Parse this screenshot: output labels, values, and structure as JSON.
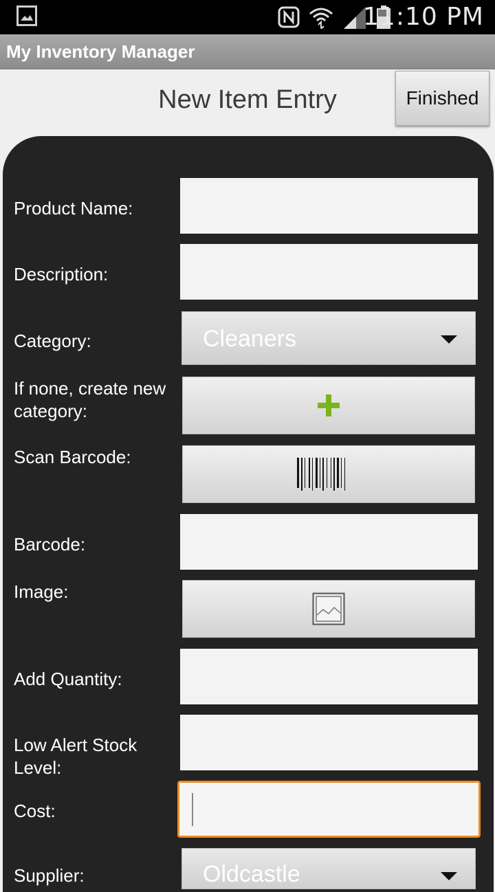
{
  "status_bar": {
    "time": "11:10 PM",
    "icons": [
      "gallery-icon",
      "nfc-icon",
      "wifi-icon",
      "signal-icon",
      "battery-icon"
    ]
  },
  "app": {
    "title": "My Inventory Manager"
  },
  "header": {
    "title": "New Item Entry",
    "finished_label": "Finished"
  },
  "form": {
    "product_name": {
      "label": "Product Name:",
      "value": ""
    },
    "description": {
      "label": "Description:",
      "value": ""
    },
    "category": {
      "label": "Category:",
      "selected": "Cleaners"
    },
    "new_category": {
      "label": "If none, create new category:",
      "icon": "plus-icon"
    },
    "scan_barcode": {
      "label": "Scan Barcode:",
      "icon": "barcode-icon"
    },
    "barcode": {
      "label": "Barcode:",
      "value": ""
    },
    "image": {
      "label": "Image:",
      "icon": "image-icon"
    },
    "add_quantity": {
      "label": "Add Quantity:",
      "value": ""
    },
    "low_alert": {
      "label": "Low Alert Stock Level:",
      "value": ""
    },
    "cost": {
      "label": "Cost:",
      "value": ""
    },
    "supplier": {
      "label": "Supplier:",
      "selected": "Oldcastle"
    }
  },
  "colors": {
    "panel": "#232323",
    "focus_border": "#f08a1d",
    "plus_green": "#79b51c"
  }
}
